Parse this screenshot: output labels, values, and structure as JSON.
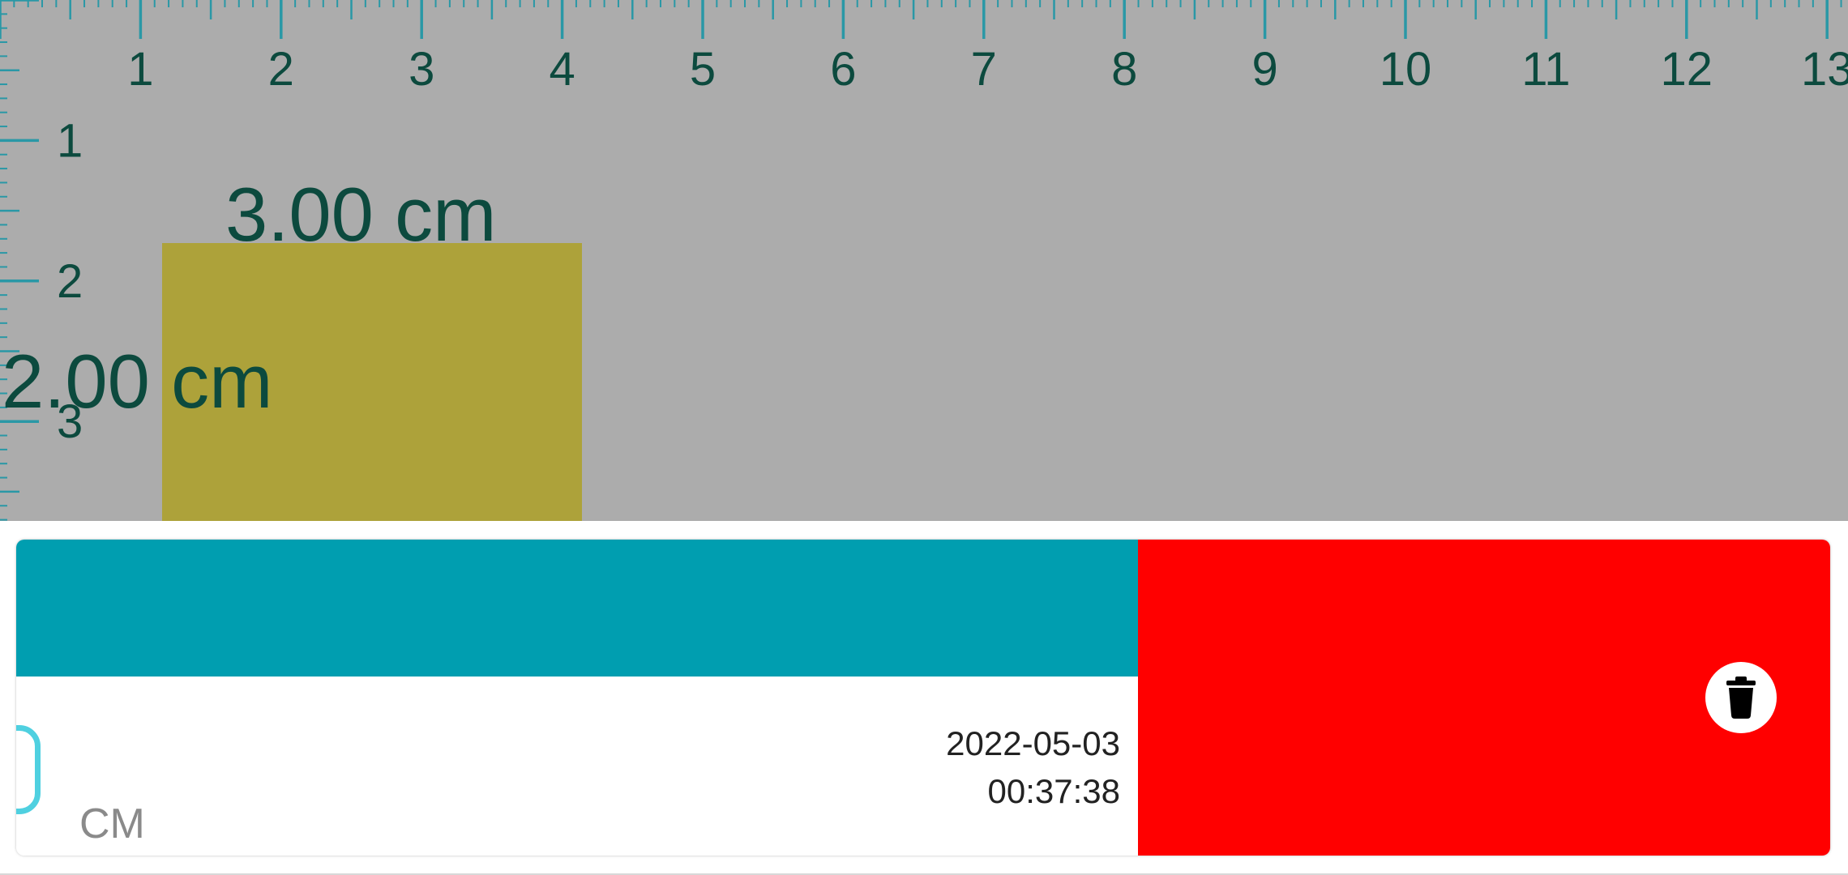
{
  "ruler": {
    "top_numbers": [
      "1",
      "2",
      "3",
      "4",
      "5",
      "6",
      "7",
      "8",
      "9",
      "10",
      "11",
      "12",
      "13"
    ],
    "left_numbers": [
      "1",
      "2",
      "3"
    ],
    "tick_color": "#2a98a6",
    "number_color": "#0c4a3e",
    "background": "#acacac"
  },
  "shape": {
    "color": "#ada23a",
    "width_label": "3.00 cm",
    "height_label": "2.00 cm"
  },
  "record": {
    "header_color": "#009eb0",
    "unit": "CM",
    "date": "2022-05-03",
    "time": "00:37:38",
    "delete_bg_color": "#ff0000",
    "delete_icon": "trash-icon"
  }
}
